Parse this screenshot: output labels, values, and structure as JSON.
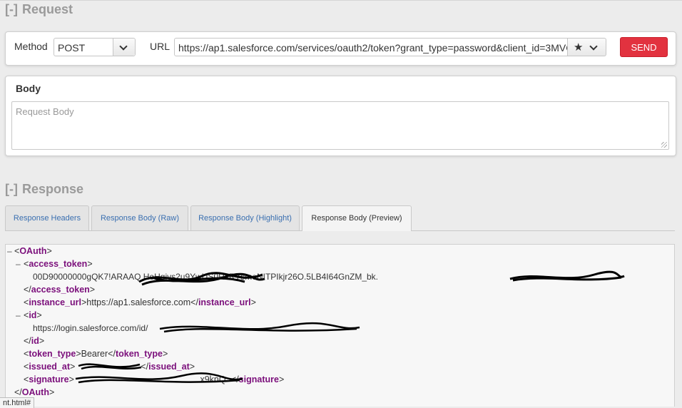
{
  "request": {
    "section_toggle": "[-]",
    "section_title": "Request",
    "method_label": "Method",
    "method_value": "POST",
    "url_label": "URL",
    "url_value": "https://ap1.salesforce.com/services/oauth2/token?grant_type=password&client_id=3MVG9Y6c",
    "send_label": "SEND",
    "star_icon": "★"
  },
  "body": {
    "title": "Body",
    "placeholder": "Request Body"
  },
  "response": {
    "section_toggle": "[-]",
    "section_title": "Response",
    "tabs": [
      {
        "label": "Response Headers",
        "active": false
      },
      {
        "label": "Response Body (Raw)",
        "active": false
      },
      {
        "label": "Response Body (Highlight)",
        "active": false
      },
      {
        "label": "Response Body (Preview)",
        "active": true
      }
    ]
  },
  "xml": {
    "collapse_glyph": "–",
    "root_tag": "OAuth",
    "access_token_tag": "access_token",
    "access_token_value": "00D90000000gQK7!ARAAQ                       HeHgiys2u9YwUS0RsRYsmeNITPIkjr26O.5LB4I64GnZM_bk.",
    "instance_url_tag": "instance_url",
    "instance_url_value": "https://ap1.salesforce.com",
    "id_tag": "id",
    "id_value": "https://login.salesforce.com/id/",
    "token_type_tag": "token_type",
    "token_type_value": "Bearer",
    "issued_at_tag": "issued_at",
    "issued_at_value": "",
    "signature_tag": "signature",
    "signature_value": "x9knQ="
  },
  "status_bar_text": "nt.html#"
}
